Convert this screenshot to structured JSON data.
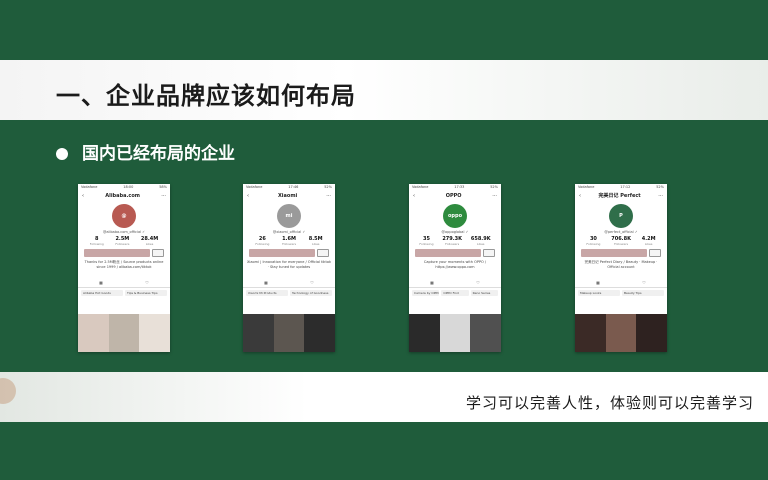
{
  "slide": {
    "title": "一、企业品牌应该如何布局",
    "subtitle": "国内已经布局的企业",
    "slogan": "学习可以完善人性，体验则可以完善学习"
  },
  "colors": {
    "green": "#1f5c3b",
    "white": "#ffffff"
  },
  "phones": [
    {
      "status": [
        "Vodafone",
        "18:00",
        "58%"
      ],
      "nav_title": "Alibaba.com",
      "handle": "@alibaba.com_official ✓",
      "avatar_color": "#b85a52",
      "avatar_text": "@",
      "stats": [
        {
          "num": "8",
          "label": "Following"
        },
        {
          "num": "2.5M",
          "label": "Followers"
        },
        {
          "num": "28.4M",
          "label": "Likes"
        }
      ],
      "bio": "Thanks for 2.5M粉丝 / Source products online since 1999 / alibaba.com/tiktok",
      "playlists": [
        "Alibaba Hot Goods",
        "Tips & Business Tips"
      ],
      "thumbs": [
        "#d9c9bf",
        "#bfb5a9",
        "#e8e0d8"
      ]
    },
    {
      "status": [
        "Vodafone",
        "17:46",
        "52%"
      ],
      "nav_title": "Xiaomi",
      "handle": "@xiaomi_official ✓",
      "avatar_color": "#9a9a9a",
      "avatar_text": "mi",
      "stats": [
        {
          "num": "26",
          "label": "Following"
        },
        {
          "num": "1.6M",
          "label": "Followers"
        },
        {
          "num": "8.5M",
          "label": "Likes"
        }
      ],
      "bio": "Xiaomi | Innovation for everyone / Official tiktok · Stay tuned for updates",
      "playlists": [
        "Xiaomi Mi Products",
        "Technology of Goodness"
      ],
      "thumbs": [
        "#3a3a3a",
        "#5c5650",
        "#2c2c2c"
      ]
    },
    {
      "status": [
        "Vodafone",
        "17:33",
        "52%"
      ],
      "nav_title": "OPPO",
      "handle": "@oppoglobal ✓",
      "avatar_color": "#2e8b3e",
      "avatar_text": "oppo",
      "stats": [
        {
          "num": "35",
          "label": "Following"
        },
        {
          "num": "279.3K",
          "label": "Followers"
        },
        {
          "num": "658.9K",
          "label": "Likes"
        }
      ],
      "bio": "Capture your moments with OPPO / https://www.oppo.com",
      "playlists": [
        "Camera by OPPO",
        "OPPO Find",
        "Reno Series"
      ],
      "thumbs": [
        "#2a2a2a",
        "#d8d8d8",
        "#505050"
      ]
    },
    {
      "status": [
        "Vodafone",
        "17:12",
        "52%"
      ],
      "nav_title": "完美日记 Perfect",
      "handle": "@perfect_official ✓",
      "avatar_color": "#2f6e4a",
      "avatar_text": "P",
      "stats": [
        {
          "num": "30",
          "label": "Following"
        },
        {
          "num": "706.8K",
          "label": "Followers"
        },
        {
          "num": "4.2M",
          "label": "Likes"
        }
      ],
      "bio": "完美日记 Perfect Diary / Beauty · Makeup · Official account",
      "playlists": [
        "Makeup Looks",
        "Beauty Tips"
      ],
      "thumbs": [
        "#3b2a26",
        "#7a5a4e",
        "#2e2220"
      ]
    }
  ]
}
